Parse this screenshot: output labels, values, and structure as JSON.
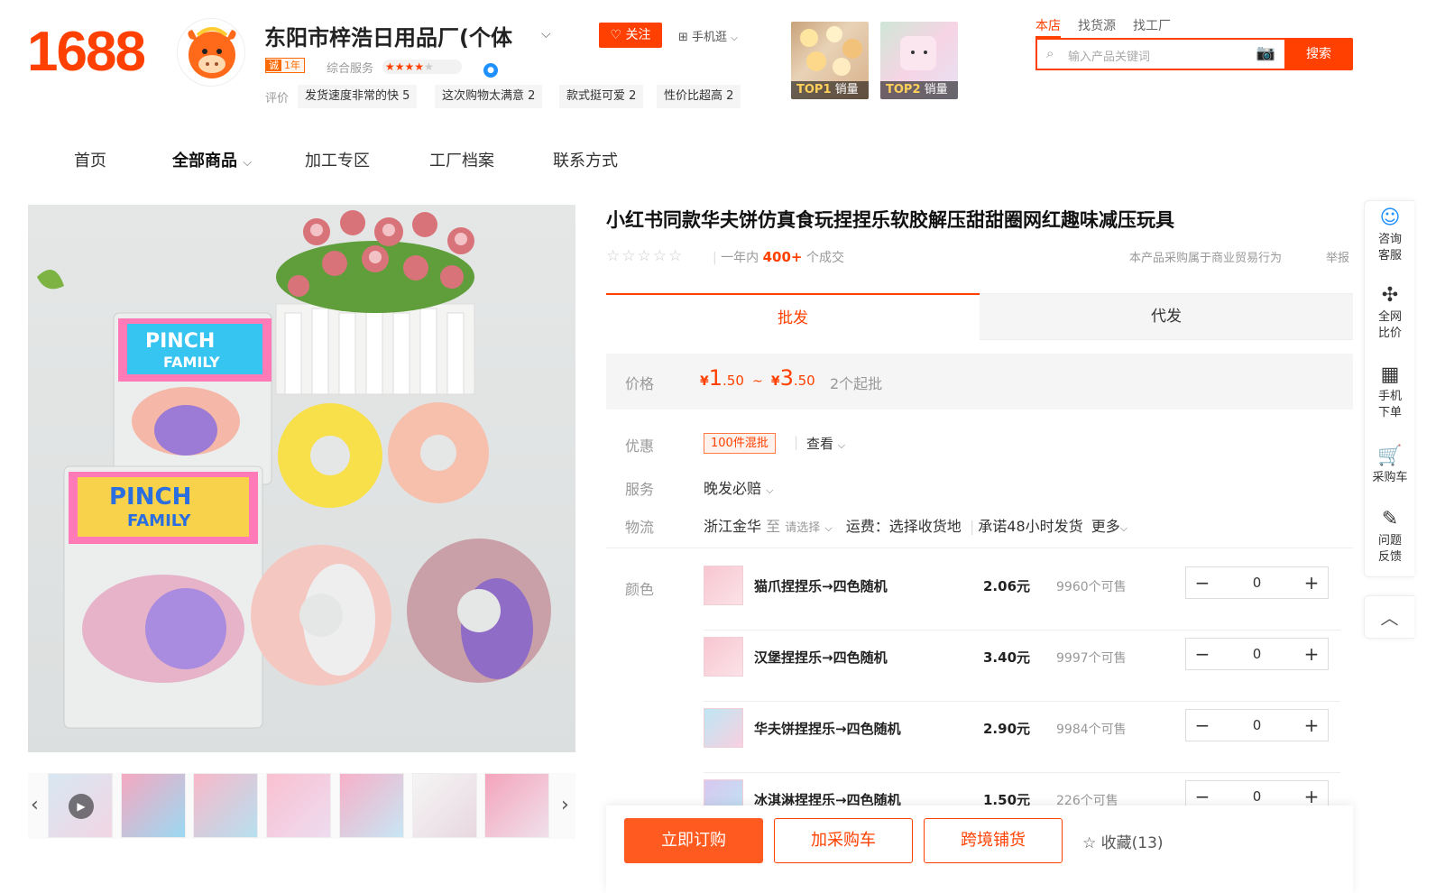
{
  "header": {
    "logo": "1688",
    "shop_name": "东阳市梓浩日用品厂(个体",
    "cheng_badge": "诚",
    "cheng_years": "1年",
    "service_label": "综合服务",
    "service_stars": "★★★★",
    "follow_label": "关注",
    "mobile_label": "手机逛",
    "review_label": "评价",
    "review_tags": [
      "发货速度非常的快 5",
      "这次购物太满意 2",
      "款式挺可爱 2",
      "性价比超高 2"
    ],
    "top_items": [
      {
        "rank": "TOP1",
        "label": "销量"
      },
      {
        "rank": "TOP2",
        "label": "销量"
      }
    ],
    "scope_tabs": [
      "本店",
      "找货源",
      "找工厂"
    ],
    "search_placeholder": "输入产品关键词",
    "search_button": "搜索"
  },
  "nav": {
    "items": [
      "首页",
      "全部商品",
      "加工专区",
      "工厂档案",
      "联系方式"
    ]
  },
  "product": {
    "title": "小红书同款华夫饼仿真食玩捏捏乐软胶解压甜甜圈网红趣味减压玩具",
    "sold_prefix": "一年内",
    "sold_count": "400+",
    "sold_suffix": "个成交",
    "legal_note": "本产品采购属于商业贸易行为",
    "report_label": "举报",
    "tabs": [
      "批发",
      "代发"
    ],
    "price_label": "价格",
    "price_low_int": "1",
    "price_low_dec": ".50",
    "price_high_int": "3",
    "price_high_dec": ".50",
    "price_currency": "¥",
    "price_sep": "~",
    "moq": "2个起批",
    "promo_label": "优惠",
    "promo_tag": "100件混批",
    "promo_view": "查看",
    "service_label": "服务",
    "service_value": "晚发必赔",
    "logistics_label": "物流",
    "logistics_from": "浙江金华",
    "logistics_to": "至",
    "logistics_select": "请选择",
    "logistics_fee": "运费：选择收货地",
    "logistics_promise": "承诺48小时发货",
    "logistics_more": "更多",
    "color_label": "颜色",
    "skus": [
      {
        "name": "猫爪捏捏乐→四色随机",
        "price": "2.06元",
        "stock": "9960个可售",
        "qty": "0"
      },
      {
        "name": "汉堡捏捏乐→四色随机",
        "price": "3.40元",
        "stock": "9997个可售",
        "qty": "0"
      },
      {
        "name": "华夫饼捏捏乐→四色随机",
        "price": "2.90元",
        "stock": "9984个可售",
        "qty": "0"
      },
      {
        "name": "冰淇淋捏捏乐→四色随机",
        "price": "1.50元",
        "stock": "226个可售",
        "qty": "0"
      }
    ]
  },
  "packaging_text": {
    "line1": "PINCH",
    "line2": "FAMILY"
  },
  "actions": {
    "buy_now": "立即订购",
    "add_cart": "加采购车",
    "cross_border": "跨境铺货",
    "favorite": "收藏(13)"
  },
  "float_bar": {
    "items": [
      {
        "icon": "chat-icon",
        "line1": "咨询",
        "line2": "客服"
      },
      {
        "icon": "puzzle-icon",
        "line1": "全网",
        "line2": "比价"
      },
      {
        "icon": "qrcode-icon",
        "line1": "手机",
        "line2": "下单"
      },
      {
        "icon": "cart-icon",
        "line1": "采购车",
        "line2": ""
      },
      {
        "icon": "edit-icon",
        "line1": "问题",
        "line2": "反馈"
      }
    ]
  },
  "colors": {
    "brand": "#ff4000",
    "accent_blue": "#1e90ff"
  }
}
